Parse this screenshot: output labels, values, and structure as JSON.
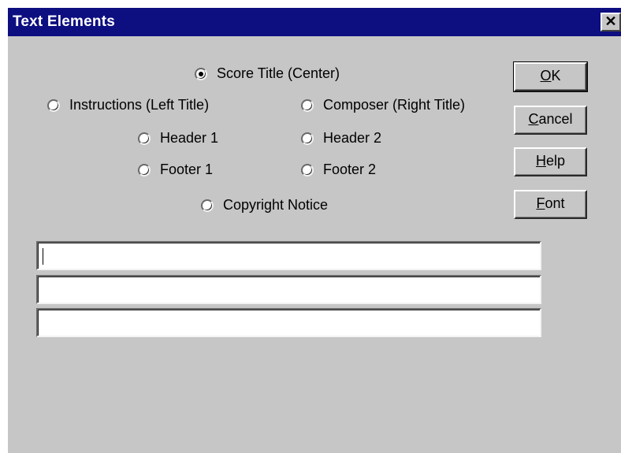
{
  "window": {
    "title": "Text Elements",
    "close_glyph": "✕"
  },
  "options": {
    "selected": "Score Title (Center)",
    "items": [
      {
        "label": "Score Title (Center)",
        "checked": true
      },
      {
        "label": "Instructions (Left Title)",
        "checked": false
      },
      {
        "label": "Composer (Right Title)",
        "checked": false
      },
      {
        "label": "Header 1",
        "checked": false
      },
      {
        "label": "Header 2",
        "checked": false
      },
      {
        "label": "Footer 1",
        "checked": false
      },
      {
        "label": "Footer 2",
        "checked": false
      },
      {
        "label": "Copyright Notice",
        "checked": false
      }
    ]
  },
  "buttons": {
    "ok": {
      "accel": "O",
      "rest": "K"
    },
    "cancel": {
      "accel": "C",
      "rest": "ancel"
    },
    "help": {
      "accel": "H",
      "rest": "elp"
    },
    "font": {
      "accel": "F",
      "rest": "ont"
    }
  },
  "text_fields": [
    {
      "value": ""
    },
    {
      "value": ""
    },
    {
      "value": ""
    }
  ],
  "colors": {
    "titlebar": "#0d0e80",
    "dialog_bg": "#c6c6c6",
    "title_text": "#ffffff"
  }
}
